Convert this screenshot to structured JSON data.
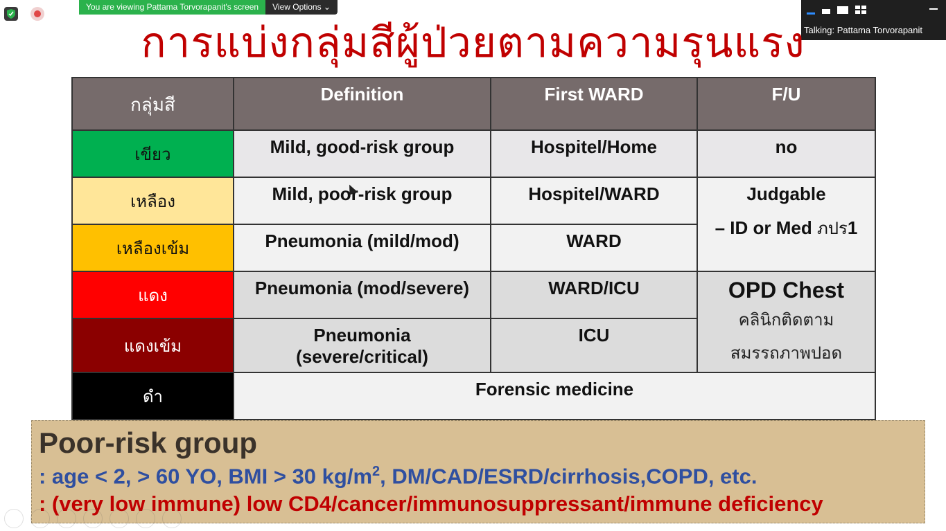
{
  "share_bar": {
    "viewing_text": "You are viewing Pattama Torvorapanit's screen",
    "view_options": "View Options ⌄"
  },
  "zoom_panel": {
    "talking": "Talking: Pattama Torvorapanit"
  },
  "slide": {
    "title": "การแบ่งกลุ่มสีผู้ป่วยตามความรุนแรง",
    "headers": [
      "กลุ่มสี",
      "Definition",
      "First WARD",
      "F/U"
    ],
    "rows": [
      {
        "color_name": "เขียว",
        "color": "#00b050",
        "text_color": "#111111",
        "definition": "Mild, good-risk group",
        "ward": "Hospitel/Home"
      },
      {
        "color_name": "เหลือง",
        "color": "#ffe699",
        "text_color": "#111111",
        "definition": "Mild, poor-risk group",
        "ward": "Hospitel/WARD"
      },
      {
        "color_name": "เหลืองเข้ม",
        "color": "#ffc000",
        "text_color": "#111111",
        "definition": "Pneumonia (mild/mod)",
        "ward": "WARD"
      },
      {
        "color_name": "แดง",
        "color": "#ff0000",
        "text_color": "#ffffff",
        "definition": "Pneumonia (mod/severe)",
        "ward": "WARD/ICU"
      },
      {
        "color_name": "แดงเข้ม",
        "color": "#8b0000",
        "text_color": "#ffffff",
        "definition_l1": "Pneumonia",
        "definition_l2": "(severe/critical)",
        "ward": "ICU"
      },
      {
        "color_name": "ดำ",
        "color": "#000000",
        "text_color": "#ffffff",
        "merged": "Forensic medicine"
      }
    ],
    "fu": {
      "green": "no",
      "yellow_l1": "Judgable",
      "yellow_l2_a": "– ID or Med ",
      "yellow_l2_b": "ภปร",
      "yellow_l2_c": "1",
      "red_title": "OPD Chest",
      "red_l2": "คลินิกติดตาม",
      "red_l3": "สมรรถภาพปอด"
    },
    "poor_risk": {
      "title": "Poor-risk group",
      "line1_a": ": age < 2, > 60 YO, BMI > 30 kg/m",
      "line1_sup": "2",
      "line1_b": ", DM/CAD/ESRD/cirrhosis,COPD, etc.",
      "line2": ": (very low immune) low CD4/cancer/immunosuppressant/immune deficiency"
    }
  }
}
